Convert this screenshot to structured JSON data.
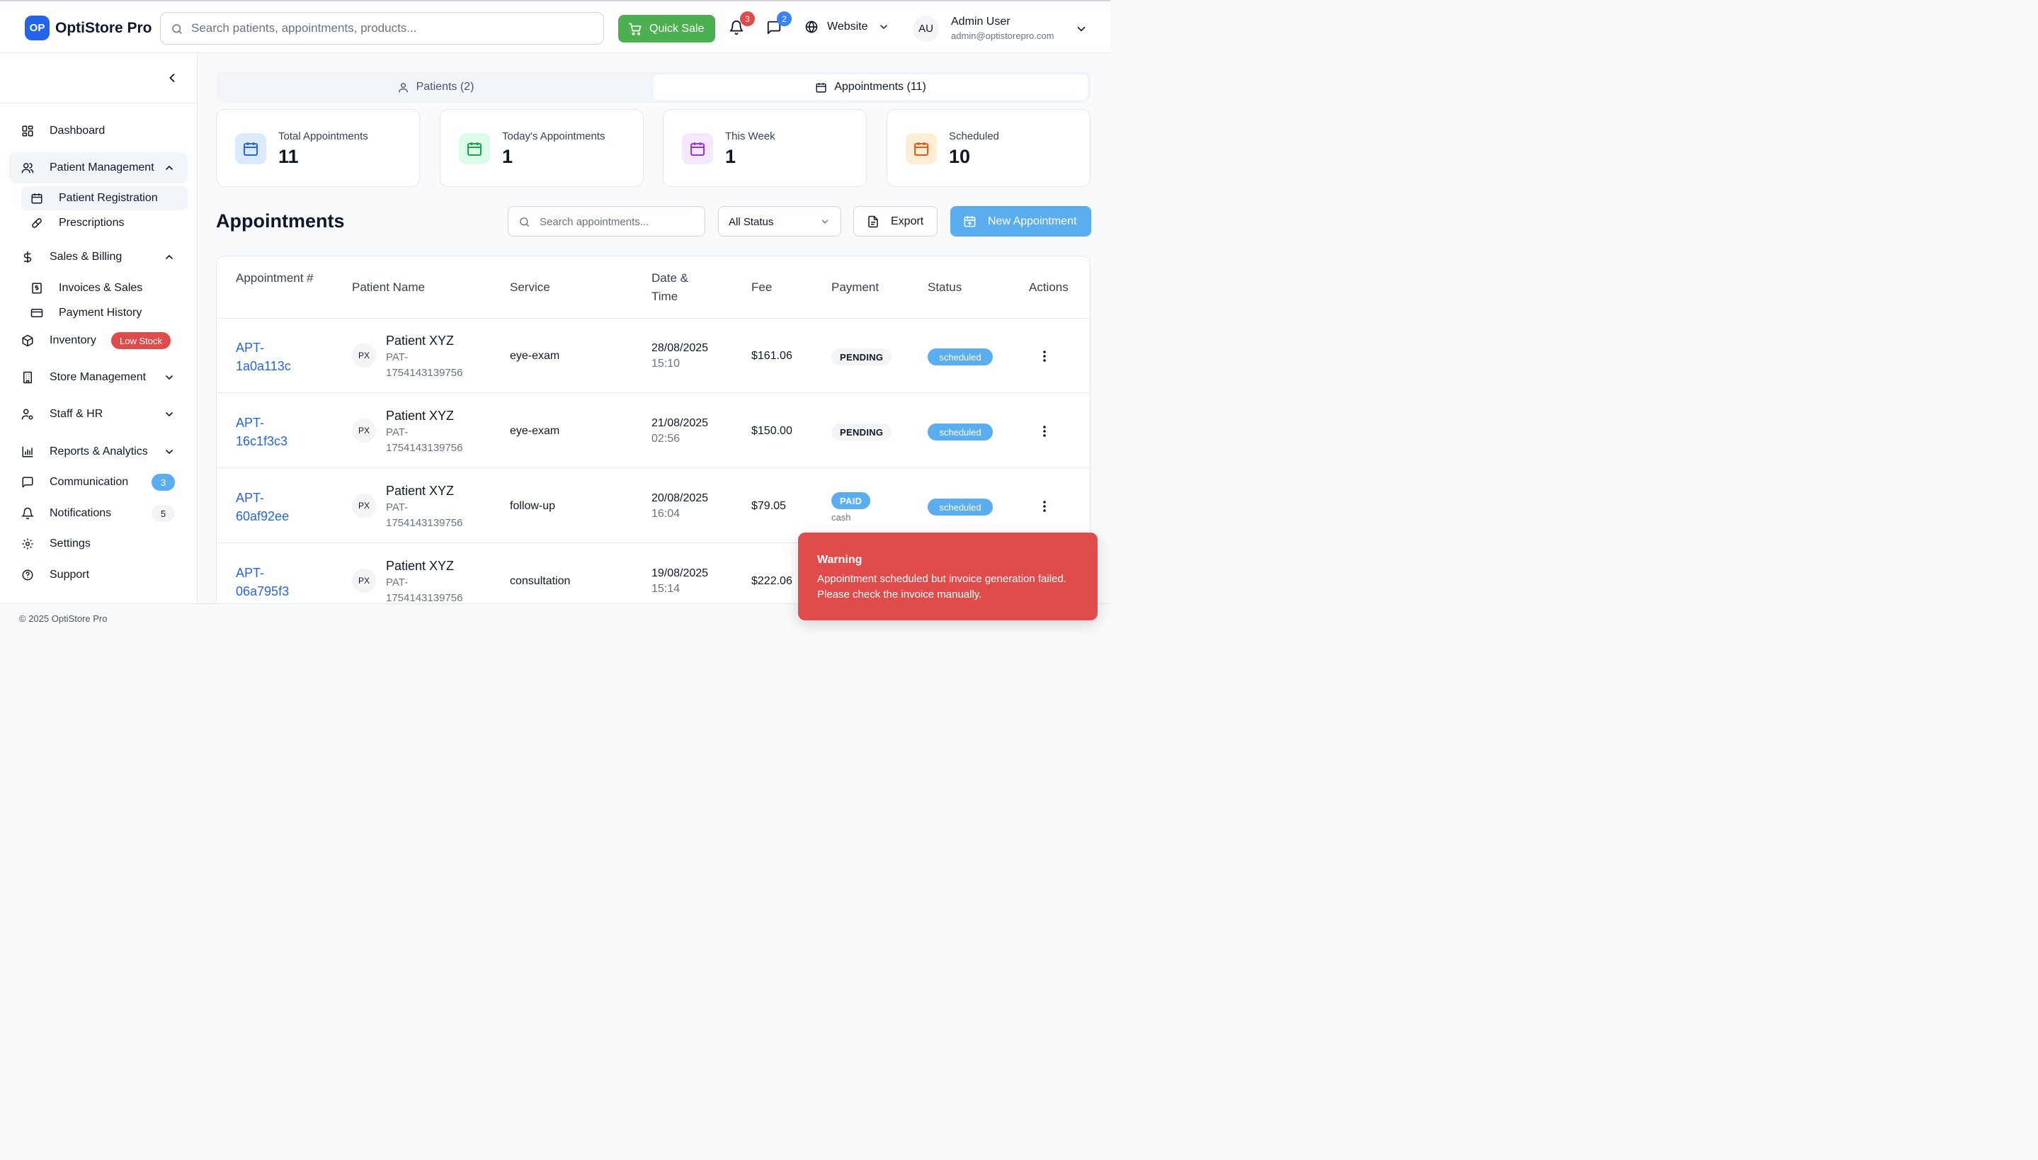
{
  "app": {
    "logo_badge": "OP",
    "name": "OptiStore Pro"
  },
  "header": {
    "search_placeholder": "Search patients, appointments, products...",
    "quick_sale_label": "Quick Sale",
    "notifications_count": "3",
    "messages_count": "2",
    "website_label": "Website",
    "user": {
      "initials": "AU",
      "name": "Admin User",
      "email": "admin@optistorepro.com"
    }
  },
  "sidebar": {
    "items": [
      {
        "label": "Dashboard",
        "icon": "grid-icon"
      },
      {
        "label": "Patient Management",
        "icon": "users-icon",
        "expanded": true,
        "active": true
      },
      {
        "label": "Patient Registration",
        "icon": "calendar-icon",
        "sub": true,
        "active": true
      },
      {
        "label": "Prescriptions",
        "icon": "pill-icon",
        "sub": true
      },
      {
        "label": "Sales & Billing",
        "icon": "dollar-icon",
        "expanded": true
      },
      {
        "label": "Invoices & Sales",
        "icon": "receipt-icon",
        "sub": true
      },
      {
        "label": "Payment History",
        "icon": "card-icon",
        "sub": true
      },
      {
        "label": "Inventory",
        "icon": "box-icon",
        "badge": "Low Stock"
      },
      {
        "label": "Store Management",
        "icon": "building-icon"
      },
      {
        "label": "Staff & HR",
        "icon": "user-cog-icon"
      },
      {
        "label": "Reports & Analytics",
        "icon": "bar-chart-icon"
      },
      {
        "label": "Communication",
        "icon": "message-icon",
        "count": "3"
      },
      {
        "label": "Notifications",
        "icon": "bell-icon",
        "count": "5"
      },
      {
        "label": "Settings",
        "icon": "gear-icon"
      },
      {
        "label": "Support",
        "icon": "help-icon"
      }
    ]
  },
  "tabs": [
    {
      "label": "Patients (2)",
      "active": false
    },
    {
      "label": "Appointments (11)",
      "active": true
    }
  ],
  "stats": [
    {
      "label": "Total Appointments",
      "value": "11",
      "color": "#2563eb",
      "bg": "#dbeafe"
    },
    {
      "label": "Today's Appointments",
      "value": "1",
      "color": "#16a34a",
      "bg": "#dcfce7"
    },
    {
      "label": "This Week",
      "value": "1",
      "color": "#9333ea",
      "bg": "#f3e8ff"
    },
    {
      "label": "Scheduled",
      "value": "10",
      "color": "#ea580c",
      "bg": "#ffedd5"
    }
  ],
  "appointments": {
    "title": "Appointments",
    "search_placeholder": "Search appointments...",
    "status_filter": "All Status",
    "export_label": "Export",
    "new_label": "New Appointment",
    "columns": [
      "Appointment #",
      "Patient Name",
      "Service",
      "Date & Time",
      "Fee",
      "Payment",
      "Status",
      "Actions"
    ],
    "rows": [
      {
        "id": "APT-1a0a113c",
        "initials": "PX",
        "patient": "Patient XYZ",
        "patient_id": "PAT-1754143139756",
        "service": "eye-exam",
        "date": "28/08/2025",
        "time": "15:10",
        "fee": "$161.06",
        "payment": "PENDING",
        "payment_method": "",
        "status": "scheduled"
      },
      {
        "id": "APT-16c1f3c3",
        "initials": "PX",
        "patient": "Patient XYZ",
        "patient_id": "PAT-1754143139756",
        "service": "eye-exam",
        "date": "21/08/2025",
        "time": "02:56",
        "fee": "$150.00",
        "payment": "PENDING",
        "payment_method": "",
        "status": "scheduled"
      },
      {
        "id": "APT-60af92ee",
        "initials": "PX",
        "patient": "Patient XYZ",
        "patient_id": "PAT-1754143139756",
        "service": "follow-up",
        "date": "20/08/2025",
        "time": "16:04",
        "fee": "$79.05",
        "payment": "PAID",
        "payment_method": "cash",
        "status": "scheduled"
      },
      {
        "id": "APT-06a795f3",
        "initials": "PX",
        "patient": "Patient XYZ",
        "patient_id": "PAT-1754143139756",
        "service": "consultation",
        "date": "19/08/2025",
        "time": "15:14",
        "fee": "$222.06",
        "payment": "",
        "payment_method": "",
        "status": ""
      }
    ]
  },
  "footer": {
    "copyright": "© 2025 OptiStore Pro"
  },
  "toast": {
    "title": "Warning",
    "message": "Appointment scheduled but invoice generation failed. Please check the invoice manually.",
    "color": "#e04b4b"
  }
}
